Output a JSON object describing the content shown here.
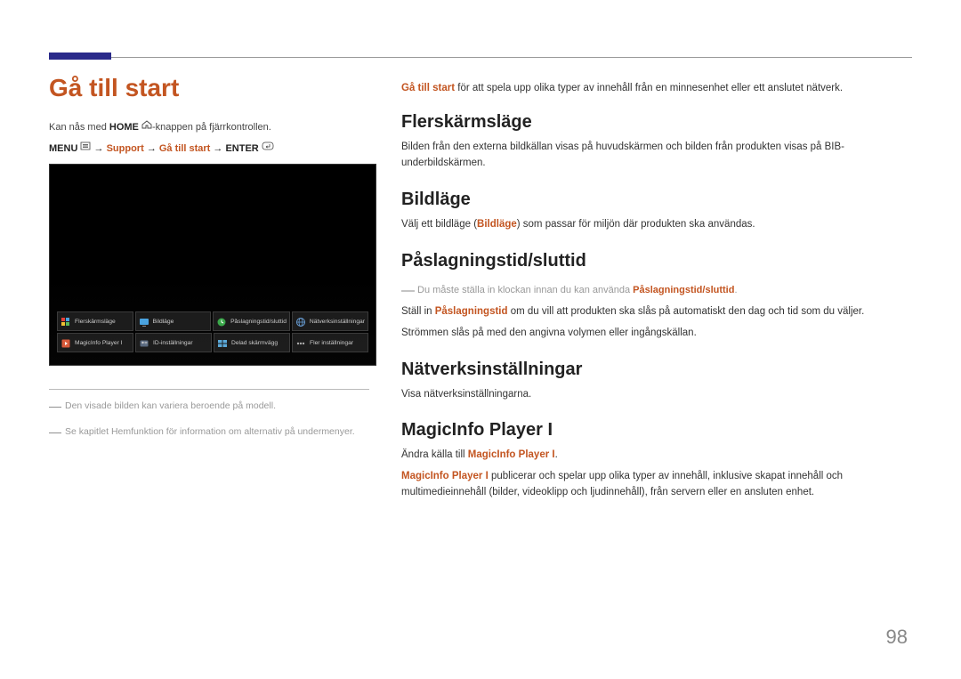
{
  "page_title": "Gå till start",
  "left": {
    "intro_prefix": "Kan nås med ",
    "intro_home": "HOME",
    "intro_suffix": "-knappen på fjärrkontrollen.",
    "breadcrumb": {
      "menu": "MENU",
      "arrow": "→",
      "support": "Support",
      "goto": "Gå till start",
      "enter": "ENTER"
    },
    "menu_items_row1": [
      "Flerskärmsläge",
      "Bildläge",
      "Påslagningstid/sluttid",
      "Nätverksinställningar"
    ],
    "menu_items_row2": [
      "MagicInfo Player I",
      "ID-inställningar",
      "Delad skärmvägg",
      "Fler inställningar"
    ],
    "footnote1": "Den visade bilden kan variera beroende på modell.",
    "footnote2": "Se kapitlet Hemfunktion för information om alternativ på undermenyer."
  },
  "right": {
    "intro_strong": "Gå till start",
    "intro_rest": " för att spela upp olika typer av innehåll från en minnesenhet eller ett anslutet nätverk.",
    "sections": {
      "flerskarm": {
        "title": "Flerskärmsläge",
        "body": "Bilden från den externa bildkällan visas på huvudskärmen och bilden från produkten visas på BIB-underbildskärmen."
      },
      "bildlage": {
        "title": "Bildläge",
        "body_pre": "Välj ett bildläge (",
        "body_bold": "Bildläge",
        "body_post": ") som passar för miljön där produkten ska användas."
      },
      "paslag": {
        "title": "Påslagningstid/sluttid",
        "note_pre": "Du måste ställa in klockan innan du kan använda ",
        "note_bold": "Påslagningstid/sluttid",
        "body_pre": "Ställ in ",
        "body_bold": "Påslagningstid",
        "body_post": " om du vill att produkten ska slås på automatiskt den dag och tid som du väljer.",
        "body2": "Strömmen slås på med den angivna volymen eller ingångskällan."
      },
      "natverk": {
        "title": "Nätverksinställningar",
        "body": "Visa nätverksinställningarna."
      },
      "magicinfo": {
        "title": "MagicInfo Player I",
        "line1_pre": "Ändra källa till ",
        "line1_bold": "MagicInfo Player I",
        "line2_bold": "MagicInfo Player I",
        "line2_rest": " publicerar och spelar upp olika typer av innehåll, inklusive skapat innehåll och multimedieinnehåll (bilder, videoklipp och ljudinnehåll), från servern eller en ansluten enhet."
      }
    }
  },
  "page_number": "98"
}
